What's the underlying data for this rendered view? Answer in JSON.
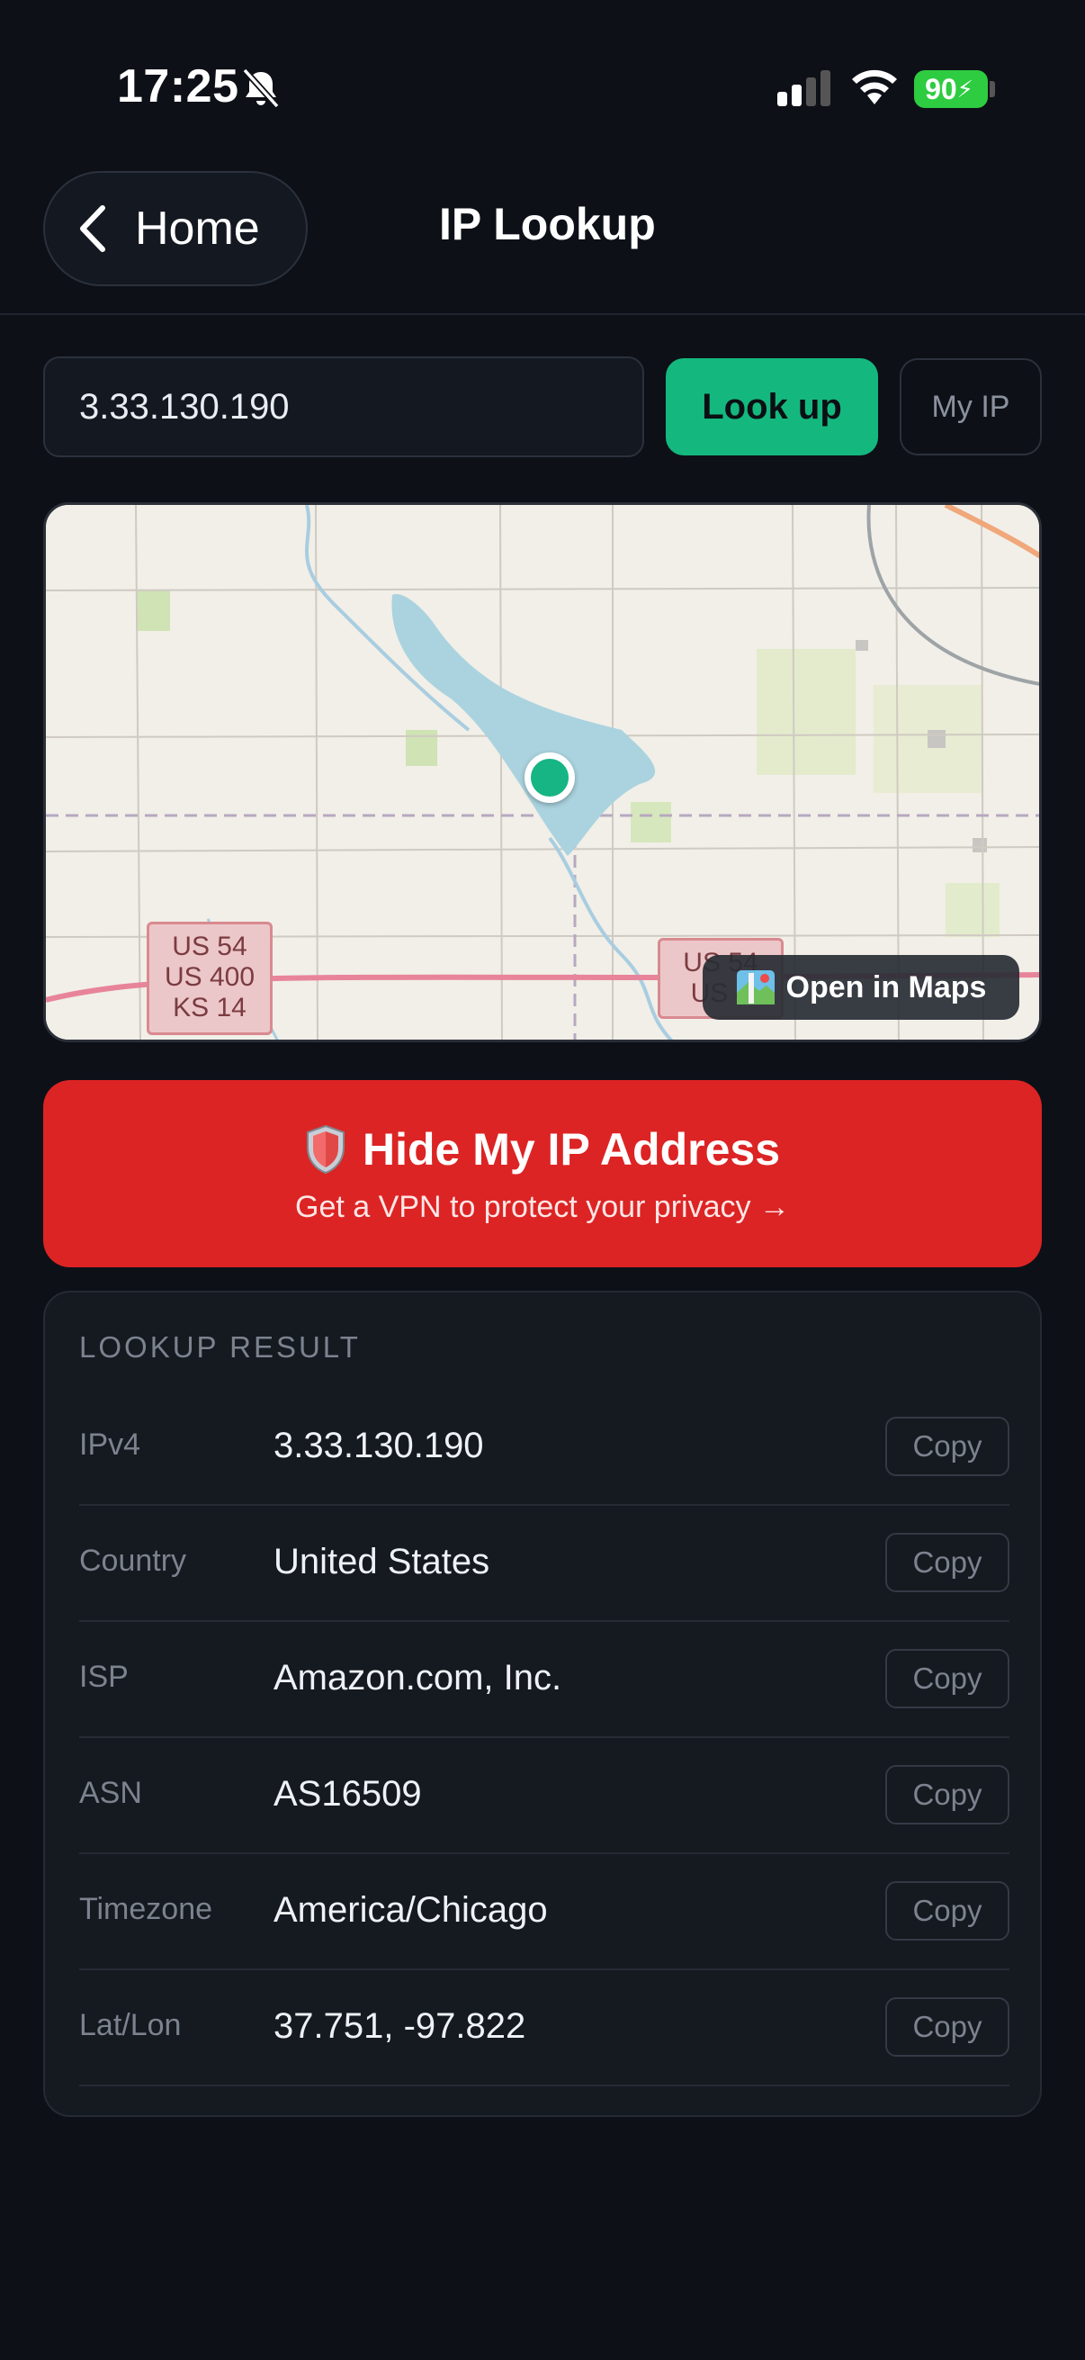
{
  "status_bar": {
    "time": "17:25",
    "battery": "90"
  },
  "header": {
    "back_label": "Home",
    "title": "IP Lookup"
  },
  "search": {
    "value": "3.33.130.190",
    "lookup_label": "Look up",
    "myip_label": "My IP"
  },
  "map": {
    "shield_a": [
      "US 54",
      "US 400",
      "KS 14"
    ],
    "shield_b": [
      "US 54",
      "US 4"
    ],
    "open_label": "Open in Maps",
    "pin_color": "#16b583"
  },
  "vpn": {
    "title": "Hide My IP Address",
    "subtitle": "Get a VPN to protect your privacy →",
    "color": "#dc2424"
  },
  "result": {
    "heading": "LOOKUP RESULT",
    "copy_label": "Copy",
    "rows": [
      {
        "label": "IPv4",
        "value": "3.33.130.190"
      },
      {
        "label": "Country",
        "value": "United States"
      },
      {
        "label": "ISP",
        "value": "Amazon.com, Inc."
      },
      {
        "label": "ASN",
        "value": "AS16509"
      },
      {
        "label": "Timezone",
        "value": "America/Chicago"
      },
      {
        "label": "Lat/Lon",
        "value": "37.751, -97.822"
      }
    ]
  },
  "accent": "#14b87e"
}
